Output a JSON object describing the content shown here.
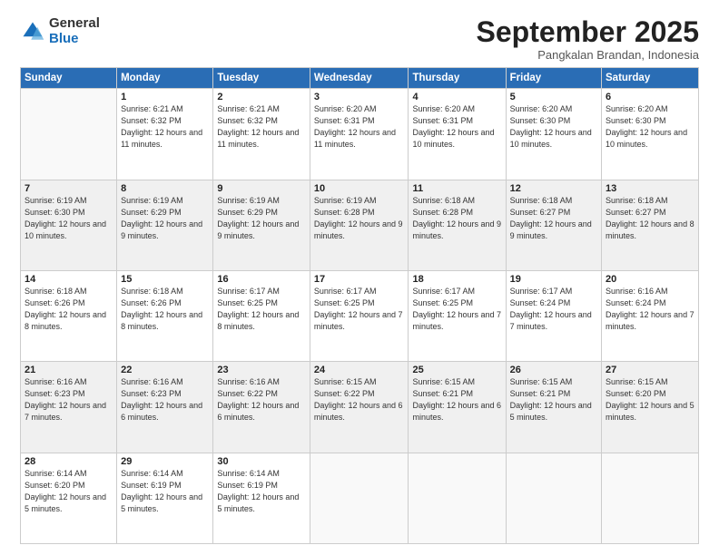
{
  "logo": {
    "general": "General",
    "blue": "Blue"
  },
  "header": {
    "month": "September 2025",
    "location": "Pangkalan Brandan, Indonesia"
  },
  "days_of_week": [
    "Sunday",
    "Monday",
    "Tuesday",
    "Wednesday",
    "Thursday",
    "Friday",
    "Saturday"
  ],
  "weeks": [
    [
      {
        "day": "",
        "sunrise": "",
        "sunset": "",
        "daylight": ""
      },
      {
        "day": "1",
        "sunrise": "6:21 AM",
        "sunset": "6:32 PM",
        "daylight": "12 hours and 11 minutes."
      },
      {
        "day": "2",
        "sunrise": "6:21 AM",
        "sunset": "6:32 PM",
        "daylight": "12 hours and 11 minutes."
      },
      {
        "day": "3",
        "sunrise": "6:20 AM",
        "sunset": "6:31 PM",
        "daylight": "12 hours and 11 minutes."
      },
      {
        "day": "4",
        "sunrise": "6:20 AM",
        "sunset": "6:31 PM",
        "daylight": "12 hours and 10 minutes."
      },
      {
        "day": "5",
        "sunrise": "6:20 AM",
        "sunset": "6:30 PM",
        "daylight": "12 hours and 10 minutes."
      },
      {
        "day": "6",
        "sunrise": "6:20 AM",
        "sunset": "6:30 PM",
        "daylight": "12 hours and 10 minutes."
      }
    ],
    [
      {
        "day": "7",
        "sunrise": "6:19 AM",
        "sunset": "6:30 PM",
        "daylight": "12 hours and 10 minutes."
      },
      {
        "day": "8",
        "sunrise": "6:19 AM",
        "sunset": "6:29 PM",
        "daylight": "12 hours and 9 minutes."
      },
      {
        "day": "9",
        "sunrise": "6:19 AM",
        "sunset": "6:29 PM",
        "daylight": "12 hours and 9 minutes."
      },
      {
        "day": "10",
        "sunrise": "6:19 AM",
        "sunset": "6:28 PM",
        "daylight": "12 hours and 9 minutes."
      },
      {
        "day": "11",
        "sunrise": "6:18 AM",
        "sunset": "6:28 PM",
        "daylight": "12 hours and 9 minutes."
      },
      {
        "day": "12",
        "sunrise": "6:18 AM",
        "sunset": "6:27 PM",
        "daylight": "12 hours and 9 minutes."
      },
      {
        "day": "13",
        "sunrise": "6:18 AM",
        "sunset": "6:27 PM",
        "daylight": "12 hours and 8 minutes."
      }
    ],
    [
      {
        "day": "14",
        "sunrise": "6:18 AM",
        "sunset": "6:26 PM",
        "daylight": "12 hours and 8 minutes."
      },
      {
        "day": "15",
        "sunrise": "6:18 AM",
        "sunset": "6:26 PM",
        "daylight": "12 hours and 8 minutes."
      },
      {
        "day": "16",
        "sunrise": "6:17 AM",
        "sunset": "6:25 PM",
        "daylight": "12 hours and 8 minutes."
      },
      {
        "day": "17",
        "sunrise": "6:17 AM",
        "sunset": "6:25 PM",
        "daylight": "12 hours and 7 minutes."
      },
      {
        "day": "18",
        "sunrise": "6:17 AM",
        "sunset": "6:25 PM",
        "daylight": "12 hours and 7 minutes."
      },
      {
        "day": "19",
        "sunrise": "6:17 AM",
        "sunset": "6:24 PM",
        "daylight": "12 hours and 7 minutes."
      },
      {
        "day": "20",
        "sunrise": "6:16 AM",
        "sunset": "6:24 PM",
        "daylight": "12 hours and 7 minutes."
      }
    ],
    [
      {
        "day": "21",
        "sunrise": "6:16 AM",
        "sunset": "6:23 PM",
        "daylight": "12 hours and 7 minutes."
      },
      {
        "day": "22",
        "sunrise": "6:16 AM",
        "sunset": "6:23 PM",
        "daylight": "12 hours and 6 minutes."
      },
      {
        "day": "23",
        "sunrise": "6:16 AM",
        "sunset": "6:22 PM",
        "daylight": "12 hours and 6 minutes."
      },
      {
        "day": "24",
        "sunrise": "6:15 AM",
        "sunset": "6:22 PM",
        "daylight": "12 hours and 6 minutes."
      },
      {
        "day": "25",
        "sunrise": "6:15 AM",
        "sunset": "6:21 PM",
        "daylight": "12 hours and 6 minutes."
      },
      {
        "day": "26",
        "sunrise": "6:15 AM",
        "sunset": "6:21 PM",
        "daylight": "12 hours and 5 minutes."
      },
      {
        "day": "27",
        "sunrise": "6:15 AM",
        "sunset": "6:20 PM",
        "daylight": "12 hours and 5 minutes."
      }
    ],
    [
      {
        "day": "28",
        "sunrise": "6:14 AM",
        "sunset": "6:20 PM",
        "daylight": "12 hours and 5 minutes."
      },
      {
        "day": "29",
        "sunrise": "6:14 AM",
        "sunset": "6:19 PM",
        "daylight": "12 hours and 5 minutes."
      },
      {
        "day": "30",
        "sunrise": "6:14 AM",
        "sunset": "6:19 PM",
        "daylight": "12 hours and 5 minutes."
      },
      {
        "day": "",
        "sunrise": "",
        "sunset": "",
        "daylight": ""
      },
      {
        "day": "",
        "sunrise": "",
        "sunset": "",
        "daylight": ""
      },
      {
        "day": "",
        "sunrise": "",
        "sunset": "",
        "daylight": ""
      },
      {
        "day": "",
        "sunrise": "",
        "sunset": "",
        "daylight": ""
      }
    ]
  ]
}
